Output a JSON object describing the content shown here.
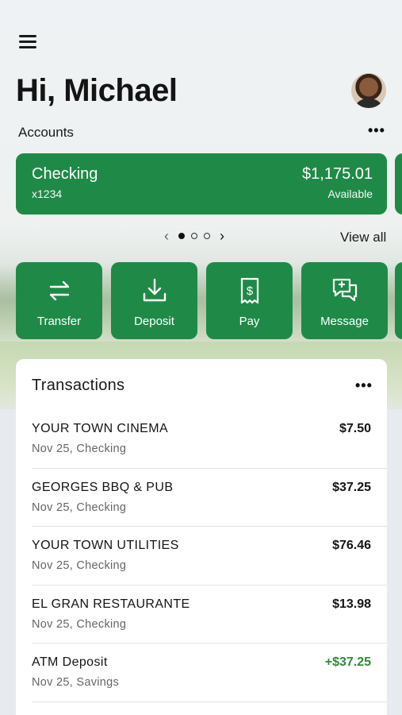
{
  "header": {
    "greeting": "Hi, Michael"
  },
  "accounts": {
    "label": "Accounts",
    "card": {
      "name": "Checking",
      "number": "x1234",
      "balance": "$1,175.01",
      "balance_label": "Available"
    },
    "pager": {
      "total": 3,
      "active": 1
    },
    "view_all": "View all"
  },
  "actions": [
    {
      "label": "Transfer",
      "icon": "transfer-icon"
    },
    {
      "label": "Deposit",
      "icon": "deposit-icon"
    },
    {
      "label": "Pay",
      "icon": "pay-icon"
    },
    {
      "label": "Message",
      "icon": "message-icon"
    }
  ],
  "transactions": {
    "title": "Transactions",
    "items": [
      {
        "merchant": "YOUR TOWN CINEMA",
        "meta": "Nov 25, Checking",
        "amount": "$7.50",
        "credit": false
      },
      {
        "merchant": "GEORGES BBQ & PUB",
        "meta": "Nov 25, Checking",
        "amount": "$37.25",
        "credit": false
      },
      {
        "merchant": "YOUR TOWN UTILITIES",
        "meta": "Nov 25, Checking",
        "amount": "$76.46",
        "credit": false
      },
      {
        "merchant": "EL GRAN RESTAURANTE",
        "meta": "Nov 25, Checking",
        "amount": "$13.98",
        "credit": false
      },
      {
        "merchant": "ATM Deposit",
        "meta": "Nov 25, Savings",
        "amount": "+$37.25",
        "credit": true
      }
    ]
  },
  "colors": {
    "brand_green": "#1f8a47",
    "credit_green": "#2e8b3a"
  }
}
